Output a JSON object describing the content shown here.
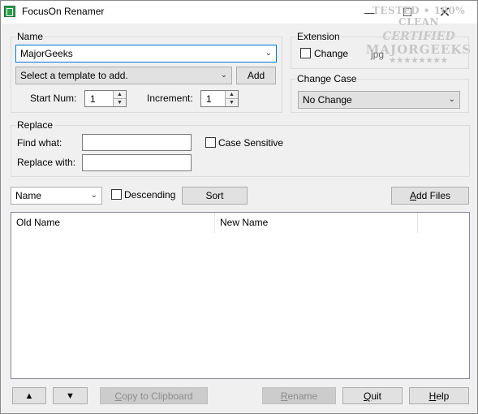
{
  "window": {
    "title": "FocusOn Renamer",
    "min_glyph": "—",
    "max_glyph": "☐",
    "close_glyph": "✕"
  },
  "watermark": {
    "line1": "TESTED • 100% CLEAN",
    "line2": "CERTIFIED",
    "line3": "MAJORGEEKS",
    "stars": "★★★★★★★★"
  },
  "name_group": {
    "label": "Name",
    "name_value": "MajorGeeks",
    "template_placeholder": "Select a template to add.",
    "add_label": "Add",
    "start_num_label": "Start Num:",
    "start_num_value": "1",
    "increment_label": "Increment:",
    "increment_value": "1"
  },
  "extension_group": {
    "label": "Extension",
    "change_label": "Change",
    "ext_value": "jpg"
  },
  "change_case_group": {
    "label": "Change Case",
    "value": "No Change"
  },
  "replace_group": {
    "label": "Replace",
    "find_label": "Find what:",
    "replace_label": "Replace with:",
    "case_sensitive_label": "Case Sensitive"
  },
  "sort_bar": {
    "sort_field": "Name",
    "descending_label": "Descending",
    "sort_label": "Sort",
    "add_files_first": "A",
    "add_files_rest": "dd Files"
  },
  "file_list": {
    "columns": [
      "Old Name",
      "New Name"
    ]
  },
  "bottom": {
    "up_glyph": "▲",
    "down_glyph": "▼",
    "copy_first": "C",
    "copy_rest": "opy to Clipboard",
    "rename_first": "R",
    "rename_rest": "ename",
    "quit_first": "Q",
    "quit_rest": "uit",
    "help_first": "H",
    "help_rest": "elp"
  }
}
